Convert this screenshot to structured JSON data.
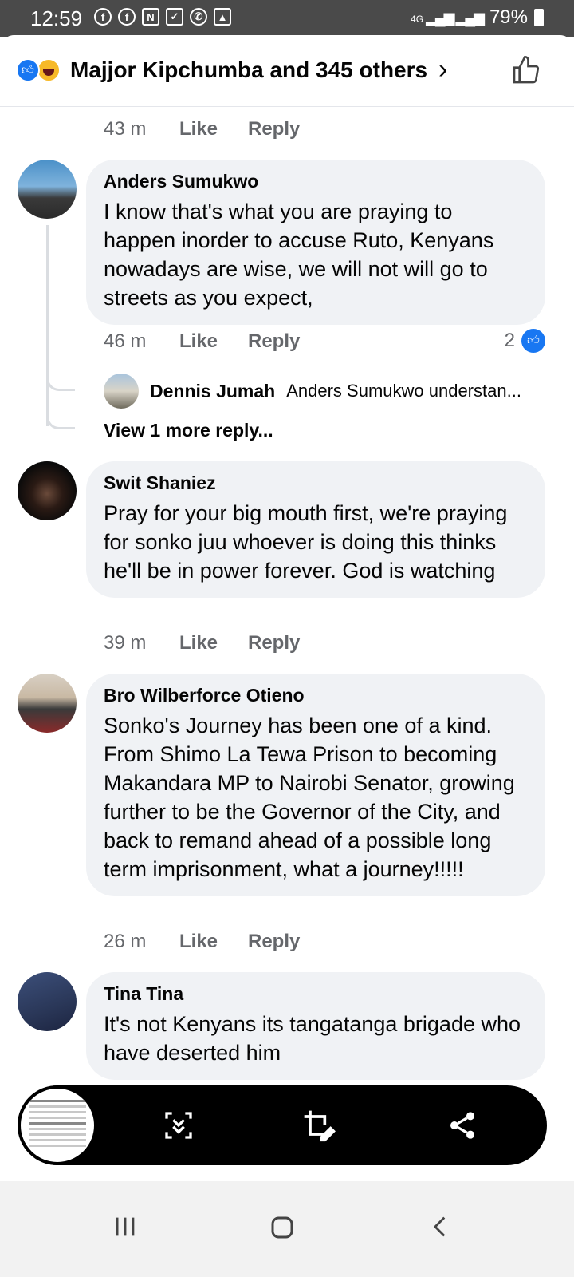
{
  "status_bar": {
    "time": "12:59",
    "notification_icons": [
      "facebook-icon",
      "facebook-icon",
      "n-icon",
      "check-icon",
      "whatsapp-icon",
      "gallery-icon"
    ],
    "network": "4G",
    "battery": "79%"
  },
  "header": {
    "title": "Majjor Kipchumba and 345 others",
    "reactions": [
      "like",
      "haha"
    ]
  },
  "comments": [
    {
      "time": "43 m",
      "like_label": "Like",
      "reply_label": "Reply"
    },
    {
      "author": "Anders Sumukwo",
      "text": "I know that's what you are praying to happen inorder to accuse Ruto, Kenyans nowadays are wise, we will not will go to streets as you expect,",
      "time": "46 m",
      "like_label": "Like",
      "reply_label": "Reply",
      "reaction_count": "2",
      "reply_preview": {
        "author": "Dennis Jumah",
        "text": "Anders Sumukwo understan..."
      },
      "view_more": "View 1 more reply..."
    },
    {
      "author": "Swit Shaniez",
      "text": "Pray for your big mouth first, we're praying for sonko juu whoever is doing this thinks he'll be in power forever. God is watching",
      "time": "39 m",
      "like_label": "Like",
      "reply_label": "Reply"
    },
    {
      "author": "Bro Wilberforce Otieno",
      "text": "Sonko's Journey has been one of a kind. From Shimo La Tewa Prison to becoming Makandara MP to Nairobi Senator, growing further to be the Governor of the City, and back to remand ahead of a possible long term imprisonment, what a journey!!!!!",
      "time": "26 m",
      "like_label": "Like",
      "reply_label": "Reply"
    },
    {
      "author": "Tina Tina",
      "text": "It's not Kenyans its tangatanga brigade who have deserted him"
    }
  ],
  "screenshot_toolbar": {
    "icons": [
      "scroll-capture-icon",
      "crop-edit-icon",
      "share-icon"
    ]
  },
  "nav_bar": {
    "icons": [
      "recents-icon",
      "home-icon",
      "back-icon"
    ]
  },
  "colors": {
    "accent": "#1877f2",
    "bubble": "#f0f2f5",
    "meta_text": "#65676b"
  }
}
